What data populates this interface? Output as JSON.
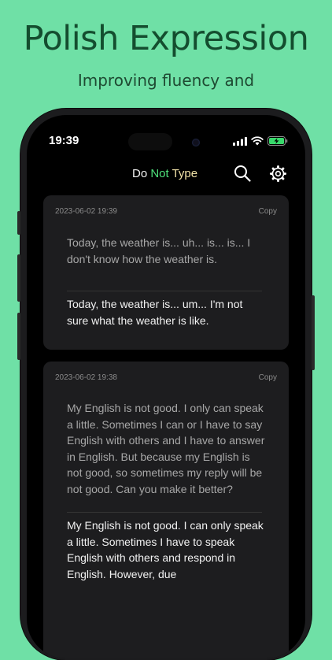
{
  "marketing": {
    "headline": "Polish Expression",
    "subline": "Improving fluency and"
  },
  "status_bar": {
    "time": "19:39",
    "icons": [
      "cellular-signal-icon",
      "wifi-icon",
      "battery-charging-icon"
    ]
  },
  "app_bar": {
    "title_part1": "Do ",
    "title_part2": "Not",
    "title_part3": " Type",
    "icons": [
      "search-icon",
      "gear-icon"
    ]
  },
  "colors": {
    "background": "#6fe0a6",
    "headline": "#144d2f",
    "title_accent_not": "#4ee07a",
    "title_accent_type": "#f2e3a8"
  },
  "cards": [
    {
      "timestamp": "2023-06-02 19:39",
      "copy_label": "Copy",
      "original": "Today, the weather is... uh... is... is... I don't know how the weather is.",
      "polished": "Today, the weather is... um... I'm not sure what the weather is like."
    },
    {
      "timestamp": "2023-06-02 19:38",
      "copy_label": "Copy",
      "original": "My English is not good. I only can speak a little. Sometimes I can or I have to say English with others and I have to answer in English. But because my English is not good, so sometimes my reply will be not good. Can you make it better?",
      "polished": "My English is not good. I can only speak a little. Sometimes I have to speak English with others and respond in English. However, due"
    }
  ]
}
